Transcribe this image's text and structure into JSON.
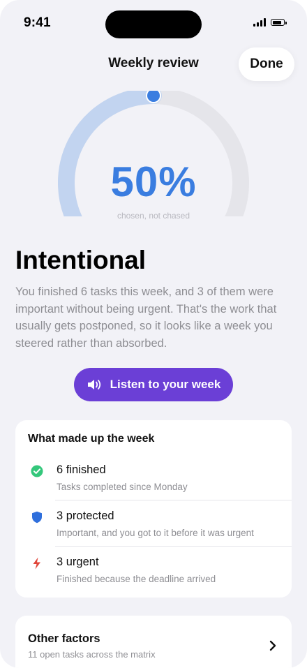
{
  "status_bar": {
    "time": "9:41"
  },
  "nav": {
    "title": "Weekly review",
    "done_label": "Done"
  },
  "gauge": {
    "value_text": "50%",
    "fraction": 0.5,
    "caption": "chosen, not chased",
    "track_color": "#e5e5ea",
    "fill_color": "#c2d4f0",
    "knob_color": "#3a7de0"
  },
  "summary": {
    "headline": "Intentional",
    "body": "You finished 6 tasks this week, and 3 of them were important without being urgent. That's the work that usually gets postponed, so it looks like a week you steered rather than absorbed."
  },
  "listen": {
    "label": "Listen to your week",
    "icon": "speaker-icon",
    "color": "#6b3fd6"
  },
  "breakdown": {
    "title": "What made up the week",
    "items": [
      {
        "icon": "check-circle-icon",
        "color": "#34c77b",
        "title": "6 finished",
        "subtitle": "Tasks completed since Monday"
      },
      {
        "icon": "shield-icon",
        "color": "#2f6fdc",
        "title": "3 protected",
        "subtitle": "Important, and you got to it before it was urgent"
      },
      {
        "icon": "bolt-icon",
        "color": "#e0463a",
        "title": "3 urgent",
        "subtitle": "Finished because the deadline arrived"
      }
    ]
  },
  "other": {
    "title": "Other factors",
    "subtitle": "11 open tasks across the matrix"
  }
}
